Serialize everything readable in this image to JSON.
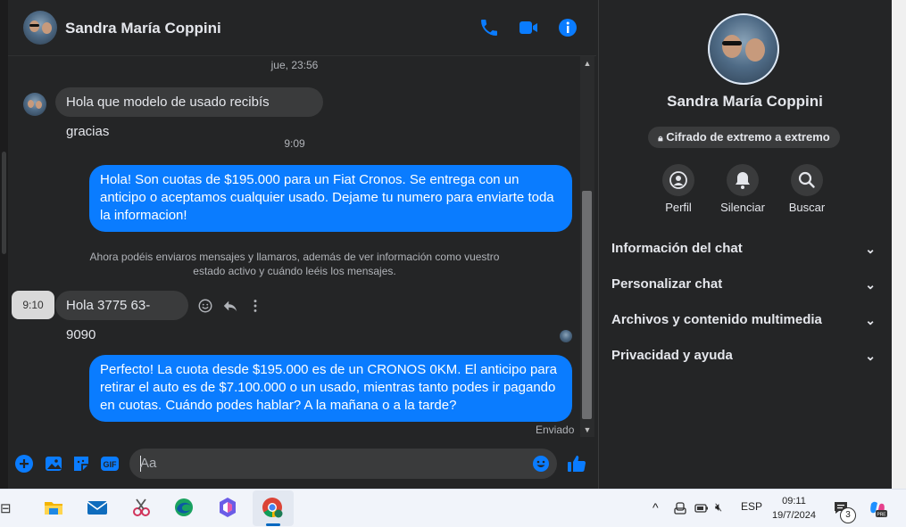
{
  "contact": {
    "name": "Sandra María Coppini"
  },
  "header": {
    "phone_icon": "phone-icon",
    "video_icon": "video-icon",
    "info_icon": "info-icon",
    "accent": "#0a7cff"
  },
  "messages": {
    "ts1": "jue, 23:56",
    "in1": "Hola que modelo de usado recibís gracias",
    "ts2": "9:09",
    "out1": "Hola! Son cuotas de $195.000 para un Fiat Cronos. Se entrega con un anticipo o aceptamos cualquier usado. Dejame tu numero para enviarte toda la informacion!",
    "system_note": "Ahora podéis enviaros mensajes y llamaros, además de ver información como vuestro estado activo y cuándo leéis los mensajes.",
    "hover_time": "9:10",
    "in2": "Hola 3775 63-9090",
    "out2": "Perfecto! La cuota desde $195.000 es de un CRONOS 0KM. El anticipo para retirar el auto es de $7.100.000 o un usado, mientras tanto podes ir pagando en cuotas. Cuándo podes hablar? A la mañana o a la tarde?",
    "status": "Enviado"
  },
  "composer": {
    "placeholder": "Aa"
  },
  "panel": {
    "name": "Sandra María Coppini",
    "encryption": "Cifrado de extremo a extremo",
    "actions": [
      {
        "label": "Perfil"
      },
      {
        "label": "Silenciar"
      },
      {
        "label": "Buscar"
      }
    ],
    "sections": [
      "Información del chat",
      "Personalizar chat",
      "Archivos y contenido multimedia",
      "Privacidad y ayuda"
    ]
  },
  "taskbar": {
    "time": "09:11",
    "date": "19/7/2024",
    "language": "ESP",
    "notifications": "3"
  }
}
